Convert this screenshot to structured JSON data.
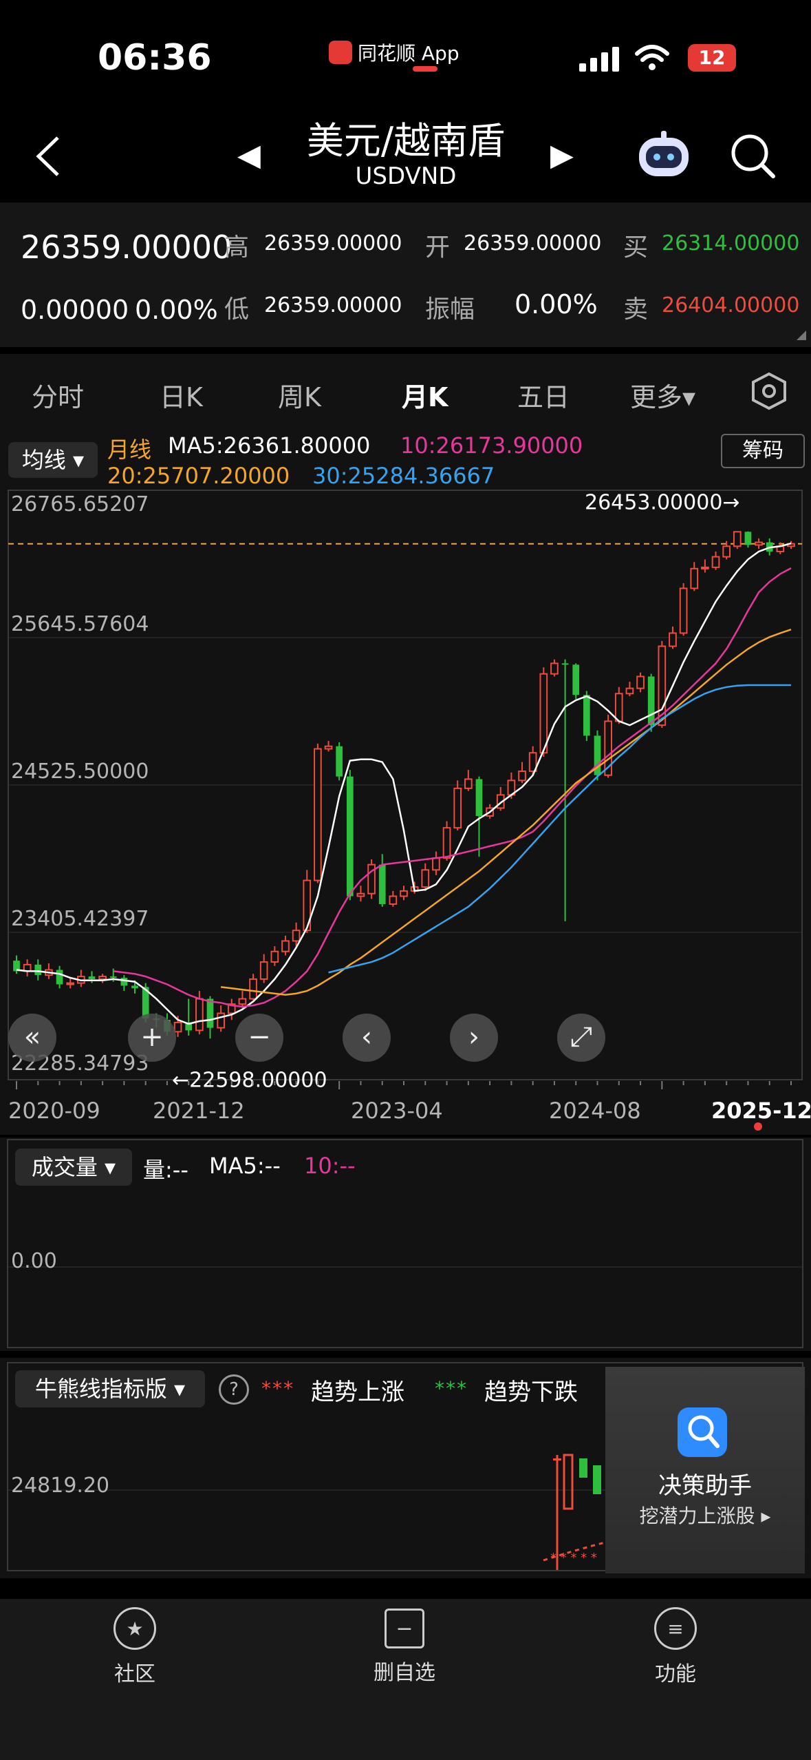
{
  "status_bar": {
    "time": "06:36",
    "app_name": "同花顺 App",
    "battery": "12"
  },
  "nav": {
    "title": "美元/越南盾",
    "subtitle": "USDVND",
    "prev": "◀",
    "next": "▶"
  },
  "quote": {
    "price": "26359.00000",
    "change": "0.00000",
    "change_pct": "0.00%",
    "high_label": "高",
    "high": "26359.00000",
    "low_label": "低",
    "low": "26359.00000",
    "open_label": "开",
    "open": "26359.00000",
    "amp_label": "振幅",
    "amp": "0.00%",
    "buy_label": "买",
    "buy": "26314.00000",
    "sell_label": "卖",
    "sell": "26404.00000"
  },
  "tabs": [
    "分时",
    "日K",
    "周K",
    "月K",
    "五日",
    "更多▾"
  ],
  "active_tab": "月K",
  "indicator": {
    "dropdown": "均线 ▾",
    "chips_button": "筹码",
    "period_label": "月线",
    "ma5": "MA5:26361.80000",
    "ma10": "10:26173.90000",
    "ma20": "20:25707.20000",
    "ma30": "30:25284.36667"
  },
  "chart_data": {
    "type": "candlestick",
    "y_ticks": [
      "26765.65207",
      "25645.57604",
      "24525.50000",
      "23405.42397",
      "22285.34793"
    ],
    "ylim": [
      22285.34793,
      26765.65207
    ],
    "x_ticks": [
      "2020-09",
      "2021-12",
      "2023-04",
      "2024-08",
      "2025-12"
    ],
    "high_annotation": "26453.00000→",
    "low_annotation": "←22598.00000",
    "candles": [
      [
        23190,
        23110,
        23230,
        23090
      ],
      [
        23110,
        23160,
        23200,
        23070
      ],
      [
        23160,
        23080,
        23200,
        23040
      ],
      [
        23080,
        23120,
        23170,
        23050
      ],
      [
        23120,
        23010,
        23150,
        22980
      ],
      [
        23010,
        23020,
        23060,
        22980
      ],
      [
        23020,
        23070,
        23120,
        22990
      ],
      [
        23070,
        23050,
        23110,
        23020
      ],
      [
        23050,
        23070,
        23090,
        23020
      ],
      [
        23070,
        23060,
        23130,
        23030
      ],
      [
        23060,
        23000,
        23080,
        22960
      ],
      [
        23000,
        22980,
        23040,
        22940
      ],
      [
        22990,
        22750,
        23020,
        22720
      ],
      [
        22750,
        22740,
        22790,
        22680
      ],
      [
        22740,
        22650,
        22790,
        22620
      ],
      [
        22650,
        22720,
        22770,
        22610
      ],
      [
        22720,
        22660,
        22900,
        22620
      ],
      [
        22660,
        22900,
        22960,
        22630
      ],
      [
        22900,
        22680,
        22920,
        22598
      ],
      [
        22680,
        22790,
        22850,
        22650
      ],
      [
        22790,
        22860,
        22900,
        22740
      ],
      [
        22860,
        22900,
        22960,
        22830
      ],
      [
        22900,
        23050,
        23090,
        22890
      ],
      [
        23050,
        23180,
        23240,
        23020
      ],
      [
        23180,
        23260,
        23300,
        23150
      ],
      [
        23260,
        23340,
        23380,
        23230
      ],
      [
        23340,
        23420,
        23480,
        23300
      ],
      [
        23420,
        23800,
        23880,
        23400
      ],
      [
        23800,
        24800,
        24840,
        23780
      ],
      [
        24800,
        24820,
        24860,
        24780
      ],
      [
        24820,
        24590,
        24850,
        24560
      ],
      [
        24590,
        23680,
        24640,
        23650
      ],
      [
        23680,
        23700,
        23760,
        23640
      ],
      [
        23700,
        23920,
        23960,
        23660
      ],
      [
        23920,
        23620,
        24000,
        23600
      ],
      [
        23620,
        23680,
        23720,
        23600
      ],
      [
        23680,
        23720,
        23760,
        23650
      ],
      [
        23720,
        23750,
        23790,
        23700
      ],
      [
        23750,
        23880,
        23930,
        23720
      ],
      [
        23880,
        23970,
        24020,
        23840
      ],
      [
        23970,
        24200,
        24250,
        23950
      ],
      [
        24200,
        24500,
        24560,
        24180
      ],
      [
        24500,
        24570,
        24640,
        24480
      ],
      [
        24570,
        24290,
        24590,
        23980
      ],
      [
        24290,
        24350,
        24380,
        24270
      ],
      [
        24350,
        24450,
        24510,
        24330
      ],
      [
        24450,
        24560,
        24620,
        24420
      ],
      [
        24560,
        24630,
        24700,
        24540
      ],
      [
        24630,
        24770,
        24820,
        24600
      ],
      [
        24770,
        25370,
        25420,
        24740
      ],
      [
        25370,
        25450,
        25480,
        25350
      ],
      [
        25450,
        25440,
        25480,
        23490
      ],
      [
        25440,
        25210,
        25450,
        25180
      ],
      [
        25210,
        24900,
        25240,
        24860
      ],
      [
        24900,
        24600,
        24940,
        24560
      ],
      [
        24600,
        25010,
        25060,
        24580
      ],
      [
        25010,
        25220,
        25270,
        24990
      ],
      [
        25220,
        25260,
        25310,
        25200
      ],
      [
        25260,
        25350,
        25380,
        25230
      ],
      [
        25350,
        24980,
        25370,
        24930
      ],
      [
        24980,
        25580,
        25620,
        24960
      ],
      [
        25580,
        25680,
        25730,
        25560
      ],
      [
        25680,
        26020,
        26060,
        25660
      ],
      [
        26020,
        26170,
        26220,
        26000
      ],
      [
        26170,
        26180,
        26240,
        26140
      ],
      [
        26180,
        26260,
        26300,
        26160
      ],
      [
        26260,
        26340,
        26380,
        26240
      ],
      [
        26340,
        26450,
        26453,
        26320
      ],
      [
        26450,
        26350,
        26453,
        26330
      ],
      [
        26350,
        26370,
        26400,
        26320
      ],
      [
        26370,
        26300,
        26400,
        26270
      ],
      [
        26300,
        26340,
        26370,
        26280
      ],
      [
        26340,
        26359,
        26380,
        26320
      ]
    ],
    "series": [
      {
        "name": "MA5",
        "values": [
          23120,
          23110,
          23110,
          23100,
          23090,
          23060,
          23040,
          23040,
          23040,
          23050,
          23040,
          23030,
          22970,
          22900,
          22820,
          22740,
          22710,
          22730,
          22740,
          22760,
          22780,
          22820,
          22880,
          22960,
          23050,
          23160,
          23290,
          23440,
          23680,
          24050,
          24440,
          24710,
          24720,
          24720,
          24700,
          24570,
          24180,
          23720,
          23730,
          23770,
          23880,
          24040,
          24210,
          24270,
          24320,
          24390,
          24450,
          24510,
          24600,
          24790,
          24990,
          25120,
          25170,
          25200,
          25160,
          25090,
          25010,
          24980,
          25020,
          25060,
          25100,
          25280,
          25460,
          25620,
          25770,
          25920,
          26040,
          26150,
          26240,
          26300,
          26330,
          26340,
          26361.8
        ]
      },
      {
        "name": "MA10",
        "values": [
          null,
          null,
          null,
          null,
          null,
          null,
          null,
          null,
          null,
          23110,
          23100,
          23090,
          23070,
          23040,
          23010,
          22970,
          22930,
          22900,
          22880,
          22870,
          22850,
          22840,
          22850,
          22870,
          22910,
          22960,
          23030,
          23110,
          23240,
          23400,
          23560,
          23700,
          23800,
          23870,
          23920,
          23930,
          23940,
          23950,
          23960,
          23970,
          23980,
          24000,
          24020,
          24040,
          24060,
          24080,
          24100,
          24130,
          24170,
          24250,
          24340,
          24430,
          24520,
          24600,
          24680,
          24750,
          24820,
          24880,
          24940,
          25000,
          25060,
          25130,
          25210,
          25290,
          25370,
          25450,
          25560,
          25700,
          25850,
          25990,
          26070,
          26130,
          26173.9
        ]
      },
      {
        "name": "MA20",
        "values": [
          null,
          null,
          null,
          null,
          null,
          null,
          null,
          null,
          null,
          null,
          null,
          null,
          null,
          null,
          null,
          null,
          null,
          null,
          null,
          22990,
          22980,
          22970,
          22960,
          22950,
          22940,
          22930,
          22940,
          22960,
          23000,
          23050,
          23100,
          23160,
          23210,
          23270,
          23330,
          23390,
          23450,
          23510,
          23570,
          23630,
          23690,
          23750,
          23810,
          23870,
          23940,
          24010,
          24080,
          24150,
          24220,
          24300,
          24380,
          24460,
          24540,
          24600,
          24660,
          24720,
          24780,
          24840,
          24900,
          24960,
          25020,
          25090,
          25160,
          25230,
          25300,
          25370,
          25440,
          25500,
          25560,
          25610,
          25650,
          25680,
          25707.2
        ]
      },
      {
        "name": "MA30",
        "values": [
          null,
          null,
          null,
          null,
          null,
          null,
          null,
          null,
          null,
          null,
          null,
          null,
          null,
          null,
          null,
          null,
          null,
          null,
          null,
          null,
          null,
          null,
          null,
          null,
          null,
          null,
          null,
          null,
          null,
          23100,
          23120,
          23140,
          23160,
          23180,
          23210,
          23250,
          23300,
          23350,
          23400,
          23450,
          23500,
          23550,
          23600,
          23670,
          23740,
          23820,
          23900,
          23990,
          24080,
          24170,
          24260,
          24350,
          24430,
          24510,
          24590,
          24660,
          24740,
          24810,
          24890,
          24960,
          25030,
          25080,
          25130,
          25180,
          25220,
          25250,
          25270,
          25280,
          25284.37,
          25284.37,
          25284.37,
          25284.37,
          25284.37
        ]
      }
    ],
    "colors": {
      "up": "#f04b3c",
      "down": "#2fbf3f",
      "ma5": "#ffffff",
      "ma10": "#e8379c",
      "ma20": "#f5a623",
      "ma30": "#36a3f0",
      "grid": "#333333"
    }
  },
  "volume": {
    "dropdown": "成交量 ▾",
    "label": "量:--",
    "ma5": "MA5:--",
    "ma10": "10:--",
    "y_tick": "0.00"
  },
  "bullbear": {
    "dropdown": "牛熊线指标版 ▾",
    "help": "?",
    "up_marker": "***",
    "up_label": "趋势上涨",
    "down_marker": "***",
    "down_label": "趋势下跌",
    "y_tick": "24819.20"
  },
  "decision": {
    "title": "决策助手",
    "subtitle": "挖潜力上涨股 ▸"
  },
  "bottom": {
    "community": "社区",
    "remove_watch": "删自选",
    "functions": "功能"
  },
  "controls": {
    "rewind": "«",
    "zoom_in": "+",
    "zoom_out": "−",
    "left": "‹",
    "right": "›",
    "fullscreen": "⤢"
  }
}
